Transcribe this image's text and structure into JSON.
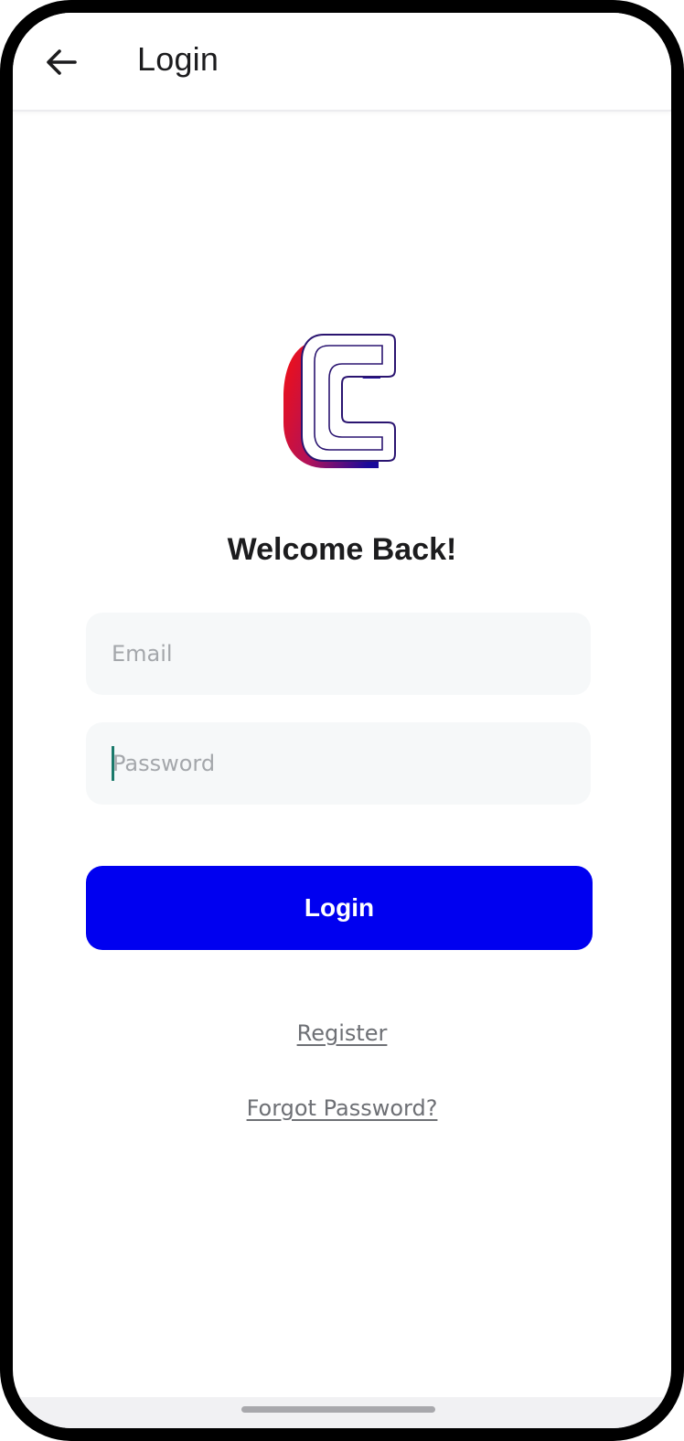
{
  "app_bar": {
    "title": "Login",
    "back_icon": "arrow-left-icon"
  },
  "logo": {
    "letter": "C",
    "gradient_colors": [
      "#e8101f",
      "#1a0a9a"
    ]
  },
  "welcome": {
    "heading": "Welcome Back!"
  },
  "form": {
    "email_placeholder": "Email",
    "email_value": "",
    "password_placeholder": "Password",
    "password_value": ""
  },
  "actions": {
    "login_label": "Login",
    "register_label": "Register",
    "forgot_label": "Forgot Password?"
  },
  "colors": {
    "primary": "#0000f0",
    "field_bg": "#f6f8f9",
    "link": "#6e7075"
  }
}
